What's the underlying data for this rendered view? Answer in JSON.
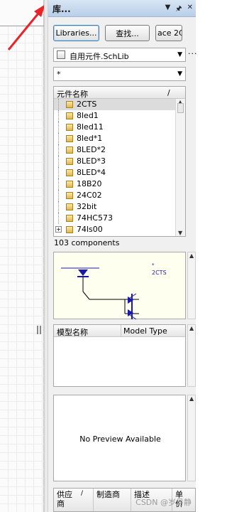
{
  "panel": {
    "title": "库...",
    "icons": [
      "dropdown-arrow-icon",
      "pin-icon",
      "close-icon"
    ],
    "buttons": {
      "libraries": "Libraries...",
      "search": "查找...",
      "place": "ace 2C"
    },
    "library_combo": {
      "value": "自用元件.SchLib"
    },
    "filter_combo": {
      "value": "*"
    },
    "more_label": "···",
    "component_list": {
      "header": "元件名称",
      "header_sort": "/",
      "items": [
        {
          "name": "2CTS",
          "selected": true
        },
        {
          "name": "8led1"
        },
        {
          "name": "8led11"
        },
        {
          "name": "8led*1"
        },
        {
          "name": "8LED*2"
        },
        {
          "name": "8LED*3"
        },
        {
          "name": "8LED*4"
        },
        {
          "name": "18B20"
        },
        {
          "name": "24C02"
        },
        {
          "name": "32bit"
        },
        {
          "name": "74HC573"
        },
        {
          "name": "74ls00",
          "expander": "+"
        }
      ],
      "count_text": "103 components"
    },
    "symbol_preview": {
      "label_a": "*",
      "label_b": "2CTS"
    },
    "model_table": {
      "columns": [
        "模型名称",
        "Model Type"
      ]
    },
    "model_preview": {
      "text": "No Preview Available"
    },
    "supplier_table": {
      "columns": [
        "供应\n商",
        "制造商",
        "描述",
        "单\n价"
      ]
    }
  },
  "watermark": "CSDN @岁月静",
  "colors": {
    "arrow": "#e8242a",
    "symbol": "#1a1aa6",
    "preview_bg": "#fffff0"
  }
}
